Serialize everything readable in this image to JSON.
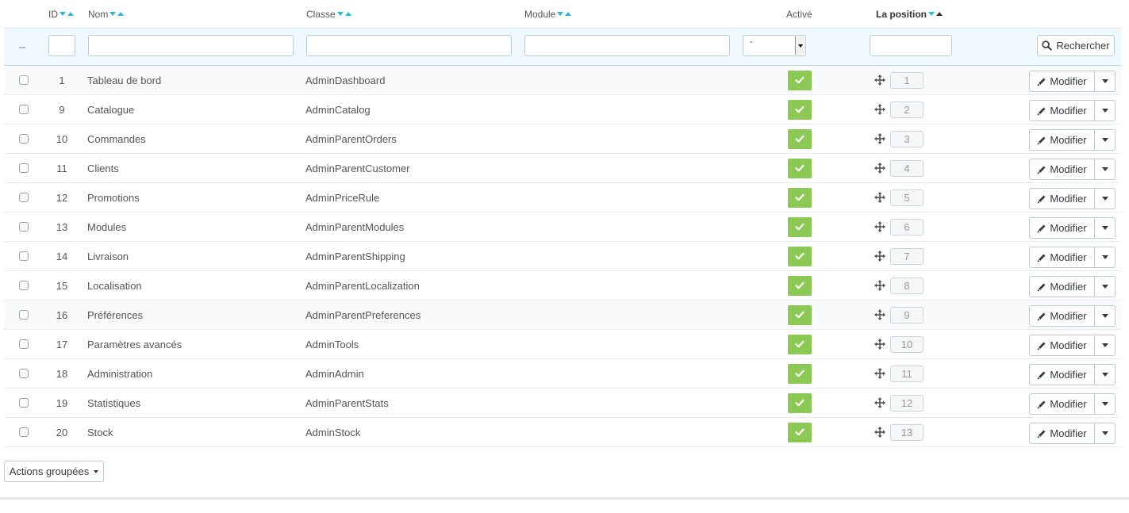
{
  "headers": {
    "id": "ID",
    "nom": "Nom",
    "classe": "Classe",
    "module": "Module",
    "active": "Activé",
    "position": "La position"
  },
  "filter": {
    "dash": "--",
    "select_value": "-",
    "search_label": "Rechercher"
  },
  "row_actions": {
    "edit_label": "Modifier"
  },
  "rows": [
    {
      "id": "1",
      "nom": "Tableau de bord",
      "classe": "AdminDashboard",
      "position": "1"
    },
    {
      "id": "9",
      "nom": "Catalogue",
      "classe": "AdminCatalog",
      "position": "2"
    },
    {
      "id": "10",
      "nom": "Commandes",
      "classe": "AdminParentOrders",
      "position": "3"
    },
    {
      "id": "11",
      "nom": "Clients",
      "classe": "AdminParentCustomer",
      "position": "4"
    },
    {
      "id": "12",
      "nom": "Promotions",
      "classe": "AdminPriceRule",
      "position": "5"
    },
    {
      "id": "13",
      "nom": "Modules",
      "classe": "AdminParentModules",
      "position": "6"
    },
    {
      "id": "14",
      "nom": "Livraison",
      "classe": "AdminParentShipping",
      "position": "7"
    },
    {
      "id": "15",
      "nom": "Localisation",
      "classe": "AdminParentLocalization",
      "position": "8"
    },
    {
      "id": "16",
      "nom": "Préférences",
      "classe": "AdminParentPreferences",
      "position": "9"
    },
    {
      "id": "17",
      "nom": "Paramètres avancés",
      "classe": "AdminTools",
      "position": "10"
    },
    {
      "id": "18",
      "nom": "Administration",
      "classe": "AdminAdmin",
      "position": "11"
    },
    {
      "id": "19",
      "nom": "Statistiques",
      "classe": "AdminParentStats",
      "position": "12"
    },
    {
      "id": "20",
      "nom": "Stock",
      "classe": "AdminStock",
      "position": "13"
    }
  ],
  "bulk_actions_label": "Actions groupées",
  "icons": {
    "sort": "sort-arrows-icon",
    "search": "search-icon",
    "check": "check-icon",
    "move": "move-arrows-icon",
    "pencil": "pencil-icon",
    "caret": "caret-down-icon"
  },
  "colors": {
    "accent": "#25b9d7",
    "enabled": "#8bc954",
    "filter_bg": "#eff8fd"
  }
}
